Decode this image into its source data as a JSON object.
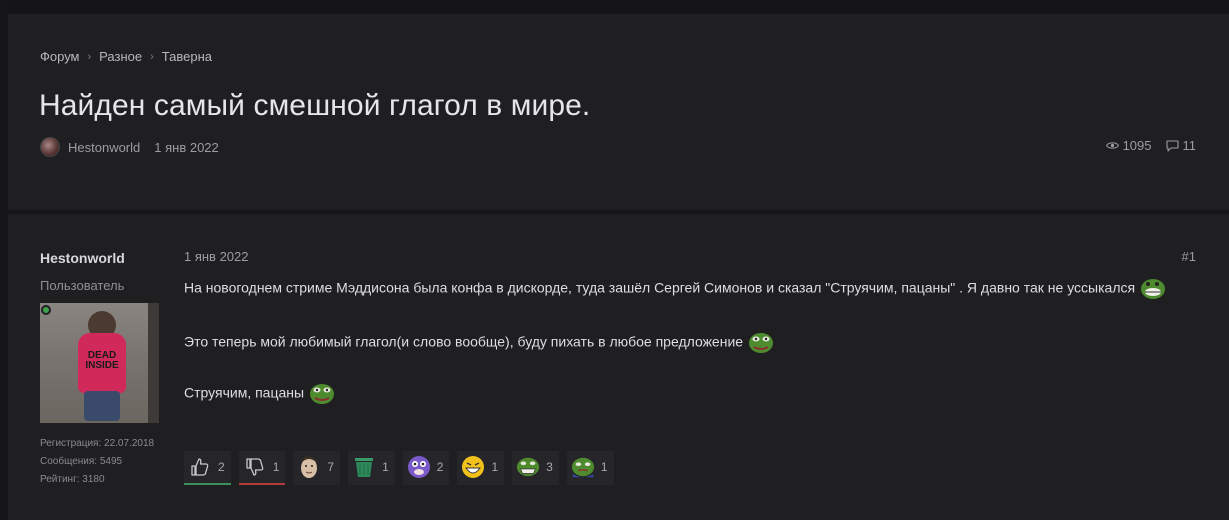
{
  "breadcrumb": [
    "Форум",
    "Разное",
    "Таверна"
  ],
  "thread": {
    "title": "Найден самый смешной глагол в мире.",
    "author": "Hestonworld",
    "date": "1 янв 2022",
    "views": "1095",
    "replies": "11"
  },
  "post": {
    "author": "Hestonworld",
    "role": "Пользователь",
    "avatar_text": "DEAD INSIDE",
    "registration": "Регистрация: 22.07.2018",
    "messages": "Сообщения: 5495",
    "rating": "Рейтинг: 3180",
    "date": "1 янв 2022",
    "number": "#1",
    "paragraphs": [
      "На новогоднем стриме Мэддисона была конфа в дискорде, туда зашёл Сергей Симонов и сказал \"Струячим, пацаны\" . Я давно так не уссыкался",
      "Это теперь мой любимый глагол(и слово вообще), буду пихать в любое предложение",
      "Струячим, пацаны"
    ]
  },
  "reactions": [
    {
      "name": "like",
      "icon": "thumbs-up-icon",
      "count": "2",
      "color": "#3a8f5c"
    },
    {
      "name": "dislike",
      "icon": "thumbs-down-icon",
      "count": "1",
      "color": "#b33a3a"
    },
    {
      "name": "face",
      "icon": "face-emoji-icon",
      "count": "7"
    },
    {
      "name": "trash",
      "icon": "trash-bin-icon",
      "count": "1"
    },
    {
      "name": "blob",
      "icon": "purple-blob-icon",
      "count": "2"
    },
    {
      "name": "grin",
      "icon": "grin-emoji-icon",
      "count": "1"
    },
    {
      "name": "pepe-laugh",
      "icon": "pepe-laugh-icon",
      "count": "3"
    },
    {
      "name": "pepe-sad",
      "icon": "pepe-sad-icon",
      "count": "1"
    }
  ]
}
